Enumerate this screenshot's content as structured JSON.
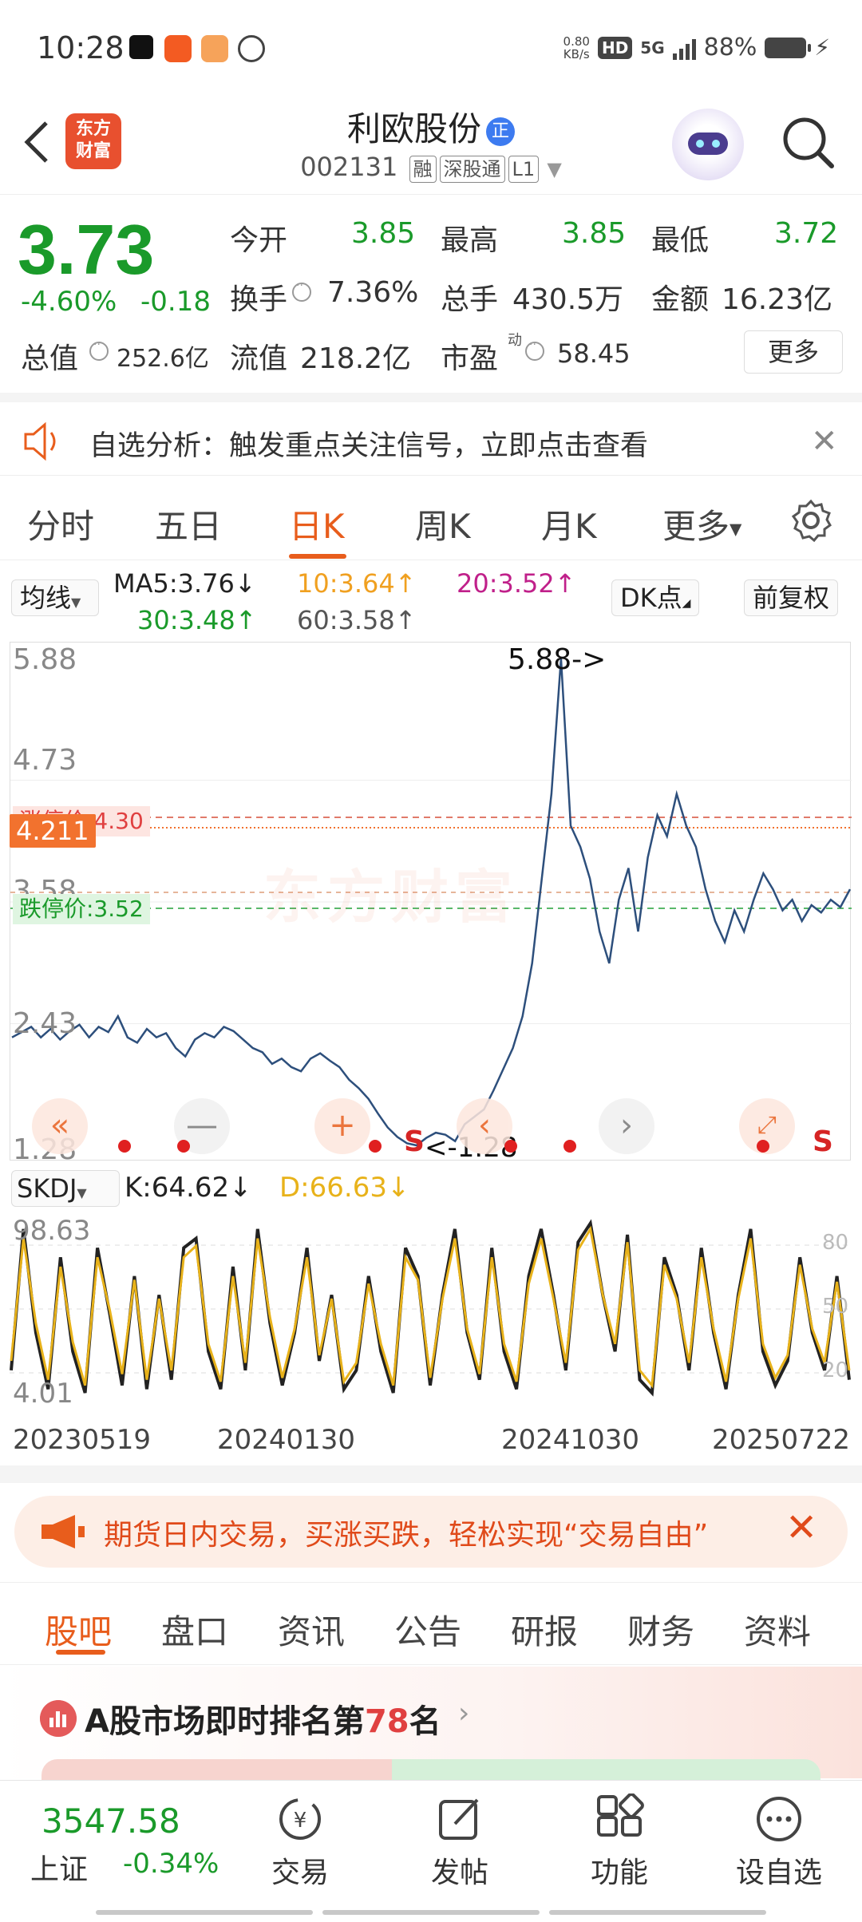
{
  "status": {
    "time": "10:28",
    "net_speed_value": "0.80",
    "net_speed_unit": "KB/s",
    "hd": "HD",
    "signal": "5G",
    "battery": "88%"
  },
  "header": {
    "logo_line1": "东方",
    "logo_line2": "财富",
    "stock_name": "利欧股份",
    "badge": "正",
    "stock_code": "002131",
    "tags": [
      "融",
      "深股通",
      "L1"
    ]
  },
  "quote": {
    "price": "3.73",
    "change_pct": "-4.60%",
    "change_amt": "-0.18",
    "open_label": "今开",
    "open": "3.85",
    "high_label": "最高",
    "high": "3.85",
    "low_label": "最低",
    "low": "3.72",
    "turnover_label": "换手",
    "turnover": "7.36%",
    "volume_label": "总手",
    "volume": "430.5万",
    "amount_label": "金额",
    "amount": "16.23亿",
    "mktcap_label": "总值",
    "mktcap": "252.6亿",
    "float_label": "流值",
    "float": "218.2亿",
    "pe_label": "市盈",
    "pe_sup": "动",
    "pe": "58.45",
    "more_label": "更多"
  },
  "notice": {
    "text": "自选分析：触发重点关注信号，立即点击查看"
  },
  "tabs": [
    "分时",
    "五日",
    "日K",
    "周K",
    "月K",
    "更多"
  ],
  "active_tab": "日K",
  "ma": {
    "selector": "均线",
    "ma5": "MA5:3.76",
    "ma10": "10:3.64",
    "ma20": "20:3.52",
    "ma30": "30:3.48",
    "ma60": "60:3.58",
    "dk_label": "DK点",
    "adj_label": "前复权",
    "color_ma5": "#222222",
    "color_ma10": "#f0a020",
    "color_ma20": "#c0208a",
    "color_ma30": "#1a9a2a",
    "color_ma60": "#555555"
  },
  "kchart": {
    "y_labels": [
      "5.88",
      "4.73",
      "3.58",
      "2.43",
      "1.28"
    ],
    "max_annotation": "5.88->",
    "min_annotation": "<-1.28",
    "current_price_tag": "4.211",
    "limit_up_label": "涨停价:4.30",
    "limit_down_label": "跌停价:3.52",
    "watermark": "东方财富",
    "signal_letter": "S"
  },
  "chart_data": {
    "type": "line",
    "title": "",
    "ylim": [
      1.28,
      5.88
    ],
    "series": [
      {
        "values": [
          2.3,
          2.35,
          2.4,
          2.3,
          2.38,
          2.28,
          2.36,
          2.42,
          2.3,
          2.4,
          2.35,
          2.5,
          2.3,
          2.25,
          2.38,
          2.3,
          2.34,
          2.2,
          2.12,
          2.28,
          2.34,
          2.3,
          2.4,
          2.36,
          2.28,
          2.2,
          2.16,
          2.05,
          2.1,
          2.02,
          1.98,
          2.1,
          2.15,
          2.08,
          2.02,
          1.9,
          1.82,
          1.72,
          1.58,
          1.45,
          1.36,
          1.3,
          1.28,
          1.35,
          1.4,
          1.38,
          1.32,
          1.48,
          1.55,
          1.62,
          1.8,
          2.0,
          2.2,
          2.5,
          3.0,
          3.8,
          4.6,
          5.88,
          4.3,
          4.1,
          3.8,
          3.3,
          3.0,
          3.6,
          3.9,
          3.3,
          4.0,
          4.4,
          4.2,
          4.6,
          4.3,
          4.1,
          3.7,
          3.4,
          3.2,
          3.5,
          3.3,
          3.6,
          3.85,
          3.7,
          3.5,
          3.6,
          3.4,
          3.55,
          3.48,
          3.6,
          3.53,
          3.7
        ]
      },
      {
        "name": "K",
        "values": [
          20,
          95,
          40,
          10,
          80,
          30,
          8,
          85,
          50,
          12,
          70,
          10,
          60,
          15,
          85,
          90,
          30,
          10,
          75,
          20,
          95,
          45,
          12,
          40,
          85,
          25,
          60,
          10,
          20,
          70,
          30,
          8,
          85,
          70,
          12,
          60,
          95,
          40,
          15,
          85,
          30,
          10,
          70,
          95,
          60,
          20,
          88,
          98,
          60,
          30,
          92,
          15,
          8,
          80,
          60,
          20,
          85,
          40,
          10,
          60,
          95,
          30,
          12,
          25,
          80,
          40,
          20,
          70,
          15
        ],
        "last": "64.62"
      },
      {
        "name": "D",
        "values": [
          25,
          90,
          45,
          15,
          75,
          35,
          12,
          80,
          52,
          18,
          68,
          15,
          58,
          20,
          80,
          86,
          34,
          14,
          70,
          24,
          90,
          48,
          16,
          42,
          80,
          28,
          58,
          14,
          24,
          66,
          34,
          12,
          80,
          68,
          16,
          58,
          90,
          42,
          18,
          80,
          34,
          14,
          66,
          90,
          58,
          24,
          84,
          95,
          60,
          34,
          88,
          20,
          12,
          76,
          58,
          24,
          80,
          42,
          14,
          58,
          90,
          34,
          16,
          28,
          76,
          42,
          24,
          67,
          20
        ],
        "last": "66.63"
      }
    ]
  },
  "skdj": {
    "selector": "SKDJ",
    "k_label": "K:64.62",
    "d_label": "D:66.63",
    "y_top": "98.63",
    "y_bottom": "4.01",
    "levels": [
      "80",
      "50",
      "20"
    ],
    "color_k": "#222222",
    "color_d": "#e8b21a"
  },
  "dates": [
    "20230519",
    "20240130",
    "20241030",
    "20250722"
  ],
  "promo": {
    "text": "期货日内交易，买涨买跌，轻松实现“交易自由”"
  },
  "sub_tabs": [
    "股吧",
    "盘口",
    "资讯",
    "公告",
    "研报",
    "财务",
    "资料"
  ],
  "rank": {
    "prefix": "A股市场即时排名第",
    "number": "78",
    "suffix": "名"
  },
  "bottom": {
    "index_value": "3547.58",
    "index_name": "上证",
    "index_change": "-0.34%",
    "items": [
      "交易",
      "发帖",
      "功能",
      "设自选"
    ]
  }
}
